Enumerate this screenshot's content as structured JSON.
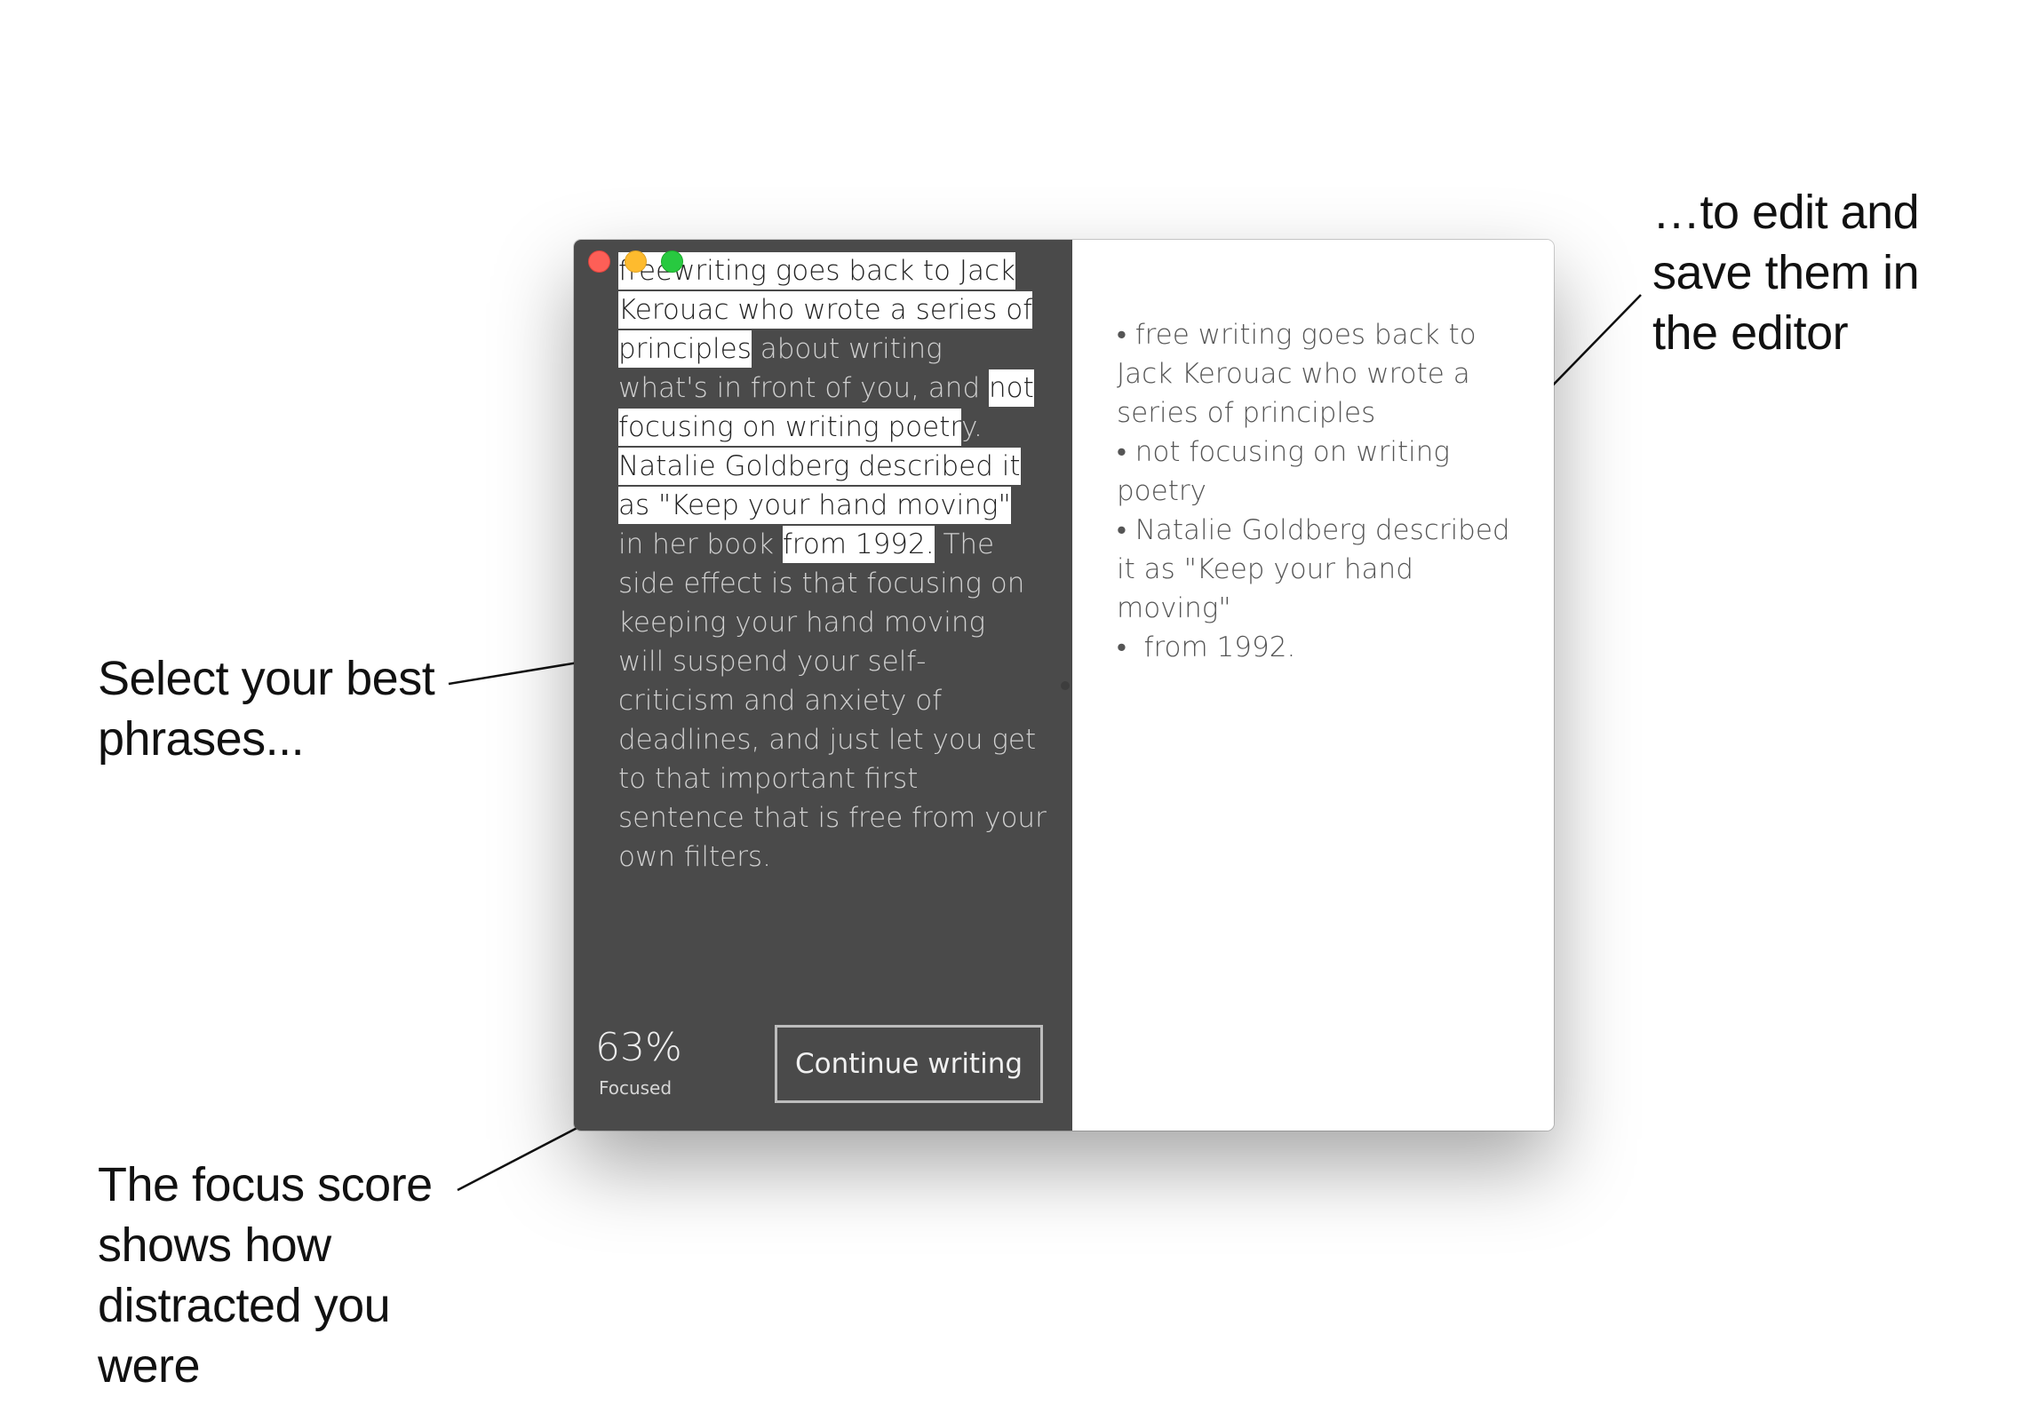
{
  "annotations": {
    "select_lines": [
      "Select your best",
      "phrases..."
    ],
    "focus_lines": [
      "The focus score",
      "shows how",
      "distracted you",
      "were"
    ],
    "edit_lines": [
      "…to edit and",
      "save them in",
      "the editor"
    ]
  },
  "window": {
    "draft_lines": [
      [
        {
          "t": "freewriting goes back to Jack",
          "h": true
        }
      ],
      [
        {
          "t": "Kerouac who wrote a series of",
          "h": true
        }
      ],
      [
        {
          "t": "principles",
          "h": true
        },
        {
          "t": " about writing",
          "h": false
        }
      ],
      [
        {
          "t": "what's in front of you, and ",
          "h": false
        },
        {
          "t": "not",
          "h": true
        }
      ],
      [
        {
          "t": "focusing on writing poetr",
          "h": true
        },
        {
          "t": "y.",
          "h": false
        }
      ],
      [
        {
          "t": "Natalie Goldberg described it",
          "h": true
        }
      ],
      [
        {
          "t": "as \"Keep your hand moving\"",
          "h": true
        }
      ],
      [
        {
          "t": "in her book ",
          "h": false
        },
        {
          "t": "from 1992.",
          "h": true
        },
        {
          "t": " The",
          "h": false
        }
      ],
      [
        {
          "t": "side effect is that focusing on",
          "h": false
        }
      ],
      [
        {
          "t": "keeping your hand moving",
          "h": false
        }
      ],
      [
        {
          "t": "will suspend your self-",
          "h": false
        }
      ],
      [
        {
          "t": "criticism and anxiety of",
          "h": false
        }
      ],
      [
        {
          "t": "deadlines, and just let you get",
          "h": false
        }
      ],
      [
        {
          "t": "to that important first",
          "h": false
        }
      ],
      [
        {
          "t": "sentence that is free from your",
          "h": false
        }
      ],
      [
        {
          "t": "own filters.",
          "h": false
        }
      ]
    ],
    "focus_score": "63%",
    "focus_label": "Focused",
    "continue_label": "Continue writing",
    "editor_lines": [
      "• free writing goes back to",
      "Jack Kerouac who wrote a",
      "series of principles",
      "• not focusing on writing",
      "poetry",
      "• Natalie Goldberg described",
      "it as \"Keep your hand",
      "moving\"",
      "•  from 1992."
    ]
  },
  "colors": {
    "draft_pane": "#4a4a4a",
    "highlight": "#ffffff",
    "close": "#fd5f57",
    "minimize": "#febb2e",
    "zoom": "#28c940"
  }
}
